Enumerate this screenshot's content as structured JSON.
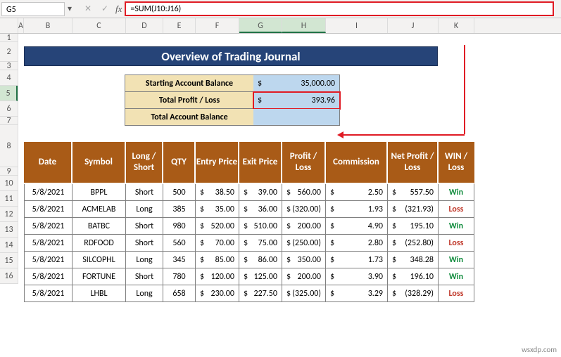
{
  "name_box": {
    "value": "G5"
  },
  "formula_bar": {
    "value": "=SUM(J10:J16)"
  },
  "columns": [
    "A",
    "B",
    "C",
    "D",
    "E",
    "F",
    "G",
    "H",
    "I",
    "J",
    "K"
  ],
  "row_nums_top": [
    "1",
    "2",
    "3",
    "4",
    "5",
    "6",
    "7",
    "8",
    "9"
  ],
  "row_nums_data": [
    "10",
    "11",
    "12",
    "13",
    "14",
    "15",
    "16"
  ],
  "overview_title": "Overview of Trading Journal",
  "summary": {
    "rows": [
      {
        "label": "Starting Account Balance",
        "cur": "$",
        "val": "35,000.00"
      },
      {
        "label": "Total Profit / Loss",
        "cur": "$",
        "val": "393.96",
        "selected": true
      },
      {
        "label": "Total Account Balance",
        "cur": "",
        "val": ""
      }
    ]
  },
  "table": {
    "headers": [
      "Date",
      "Symbol",
      "Long / Short",
      "QTY",
      "Entry Price",
      "Exit Price",
      "Profit / Loss",
      "Commission",
      "Net Profit / Loss",
      "WIN / Loss"
    ],
    "rows": [
      {
        "date": "5/8/2021",
        "sym": "BPPL",
        "ls": "Short",
        "qty": "500",
        "ep": "38.50",
        "xp": "39.00",
        "pl": "560.00",
        "com": "2.50",
        "net": "557.50",
        "wl": "Win"
      },
      {
        "date": "5/8/2021",
        "sym": "ACMELAB",
        "ls": "Long",
        "qty": "385",
        "ep": "35.00",
        "xp": "36.00",
        "pl": "(320.00)",
        "com": "1.93",
        "net": "(321.93)",
        "wl": "Loss"
      },
      {
        "date": "5/8/2021",
        "sym": "BATBC",
        "ls": "Short",
        "qty": "980",
        "ep": "520.00",
        "xp": "510.00",
        "pl": "200.00",
        "com": "4.90",
        "net": "195.10",
        "wl": "Win"
      },
      {
        "date": "5/8/2021",
        "sym": "RDFOOD",
        "ls": "Short",
        "qty": "560",
        "ep": "70.00",
        "xp": "75.00",
        "pl": "(250.00)",
        "com": "2.80",
        "net": "(252.80)",
        "wl": "Loss"
      },
      {
        "date": "5/8/2021",
        "sym": "SILCOPHL",
        "ls": "Long",
        "qty": "345",
        "ep": "85.00",
        "xp": "86.00",
        "pl": "350.00",
        "com": "1.73",
        "net": "348.28",
        "wl": "Win"
      },
      {
        "date": "5/8/2021",
        "sym": "FORTUNE",
        "ls": "Short",
        "qty": "780",
        "ep": "120.00",
        "xp": "125.00",
        "pl": "200.00",
        "com": "3.90",
        "net": "196.10",
        "wl": "Win"
      },
      {
        "date": "5/8/2021",
        "sym": "LHBL",
        "ls": "Long",
        "qty": "658",
        "ep": "230.00",
        "xp": "227.50",
        "pl": "(325.00)",
        "com": "3.29",
        "net": "(328.29)",
        "wl": "Loss"
      }
    ]
  },
  "watermark": "wsxdp.com",
  "icons": {
    "dropdown": "▾",
    "cancel": "✕",
    "enter": "✓",
    "fx": "fx"
  }
}
